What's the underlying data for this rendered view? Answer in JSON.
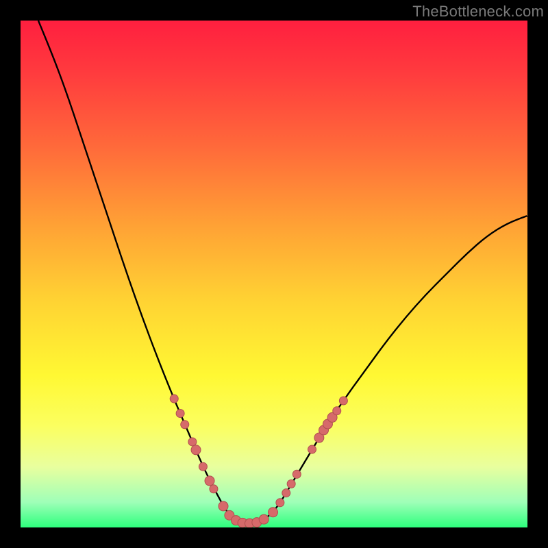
{
  "watermark": {
    "text": "TheBottleneck.com"
  },
  "colors": {
    "frame": "#000000",
    "curve": "#000000",
    "marker_fill": "#d66a6a",
    "marker_stroke": "#b04f4f",
    "gradient_stops": [
      {
        "pos": 0.0,
        "color": "#ff1f3f"
      },
      {
        "pos": 0.1,
        "color": "#ff3a3e"
      },
      {
        "pos": 0.25,
        "color": "#ff6a3a"
      },
      {
        "pos": 0.4,
        "color": "#ffa035"
      },
      {
        "pos": 0.55,
        "color": "#ffd233"
      },
      {
        "pos": 0.7,
        "color": "#fff833"
      },
      {
        "pos": 0.8,
        "color": "#fbff60"
      },
      {
        "pos": 0.88,
        "color": "#e9ff9e"
      },
      {
        "pos": 0.95,
        "color": "#9fffb8"
      },
      {
        "pos": 1.0,
        "color": "#2dff7d"
      }
    ]
  },
  "chart_data": {
    "type": "line",
    "title": "",
    "xlabel": "",
    "ylabel": "",
    "xlim": [
      0,
      1
    ],
    "ylim": [
      0,
      1
    ],
    "note": "Bottleneck-style V curve. x in [0,1] across plot width, y is fraction from top (0=top, 1=bottom). Curve drops from top-left to a flat minimum near y≈0.99 around x≈0.41–0.49, then rises to the right edge near y≈0.39.",
    "series": [
      {
        "name": "bottleneck-curve",
        "points": [
          {
            "x": 0.035,
            "y": 0.0
          },
          {
            "x": 0.06,
            "y": 0.06
          },
          {
            "x": 0.09,
            "y": 0.14
          },
          {
            "x": 0.12,
            "y": 0.23
          },
          {
            "x": 0.15,
            "y": 0.32
          },
          {
            "x": 0.18,
            "y": 0.41
          },
          {
            "x": 0.21,
            "y": 0.5
          },
          {
            "x": 0.24,
            "y": 0.585
          },
          {
            "x": 0.27,
            "y": 0.665
          },
          {
            "x": 0.3,
            "y": 0.74
          },
          {
            "x": 0.33,
            "y": 0.81
          },
          {
            "x": 0.36,
            "y": 0.88
          },
          {
            "x": 0.385,
            "y": 0.93
          },
          {
            "x": 0.41,
            "y": 0.975
          },
          {
            "x": 0.43,
            "y": 0.99
          },
          {
            "x": 0.45,
            "y": 0.993
          },
          {
            "x": 0.47,
            "y": 0.99
          },
          {
            "x": 0.49,
            "y": 0.978
          },
          {
            "x": 0.51,
            "y": 0.955
          },
          {
            "x": 0.54,
            "y": 0.905
          },
          {
            "x": 0.57,
            "y": 0.855
          },
          {
            "x": 0.6,
            "y": 0.805
          },
          {
            "x": 0.64,
            "y": 0.745
          },
          {
            "x": 0.68,
            "y": 0.69
          },
          {
            "x": 0.72,
            "y": 0.635
          },
          {
            "x": 0.76,
            "y": 0.585
          },
          {
            "x": 0.8,
            "y": 0.54
          },
          {
            "x": 0.84,
            "y": 0.5
          },
          {
            "x": 0.88,
            "y": 0.46
          },
          {
            "x": 0.92,
            "y": 0.425
          },
          {
            "x": 0.96,
            "y": 0.4
          },
          {
            "x": 1.0,
            "y": 0.385
          }
        ]
      }
    ],
    "markers": [
      {
        "x": 0.303,
        "y": 0.746,
        "r": 6
      },
      {
        "x": 0.315,
        "y": 0.775,
        "r": 6
      },
      {
        "x": 0.324,
        "y": 0.797,
        "r": 6
      },
      {
        "x": 0.339,
        "y": 0.831,
        "r": 6
      },
      {
        "x": 0.346,
        "y": 0.847,
        "r": 7
      },
      {
        "x": 0.36,
        "y": 0.88,
        "r": 6
      },
      {
        "x": 0.373,
        "y": 0.908,
        "r": 7
      },
      {
        "x": 0.381,
        "y": 0.924,
        "r": 6
      },
      {
        "x": 0.4,
        "y": 0.958,
        "r": 7
      },
      {
        "x": 0.412,
        "y": 0.976,
        "r": 7
      },
      {
        "x": 0.425,
        "y": 0.986,
        "r": 7
      },
      {
        "x": 0.438,
        "y": 0.991,
        "r": 7
      },
      {
        "x": 0.452,
        "y": 0.992,
        "r": 7
      },
      {
        "x": 0.466,
        "y": 0.99,
        "r": 7
      },
      {
        "x": 0.48,
        "y": 0.984,
        "r": 7
      },
      {
        "x": 0.498,
        "y": 0.97,
        "r": 7
      },
      {
        "x": 0.512,
        "y": 0.951,
        "r": 6
      },
      {
        "x": 0.524,
        "y": 0.932,
        "r": 6
      },
      {
        "x": 0.534,
        "y": 0.914,
        "r": 6
      },
      {
        "x": 0.545,
        "y": 0.895,
        "r": 6
      },
      {
        "x": 0.575,
        "y": 0.846,
        "r": 6
      },
      {
        "x": 0.589,
        "y": 0.823,
        "r": 7
      },
      {
        "x": 0.598,
        "y": 0.808,
        "r": 7
      },
      {
        "x": 0.606,
        "y": 0.796,
        "r": 7
      },
      {
        "x": 0.615,
        "y": 0.783,
        "r": 7
      },
      {
        "x": 0.624,
        "y": 0.77,
        "r": 6
      },
      {
        "x": 0.637,
        "y": 0.75,
        "r": 6
      }
    ]
  }
}
